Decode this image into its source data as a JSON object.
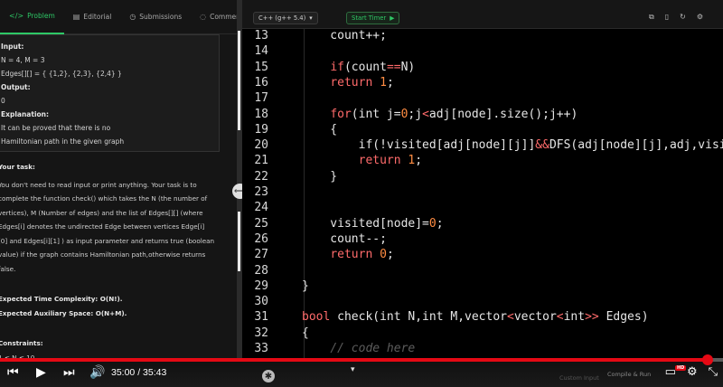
{
  "tabs": [
    {
      "icon": "</>",
      "label": "Problem",
      "active": true
    },
    {
      "icon": "▤",
      "label": "Editorial"
    },
    {
      "icon": "◷",
      "label": "Submissions"
    },
    {
      "icon": "◌",
      "label": "Comments"
    }
  ],
  "example": [
    {
      "text": "Input:",
      "bold": true
    },
    {
      "text": "N = 4, M = 3",
      "bold": false
    },
    {
      "text": "Edges[][] = { {1,2}, {2,3}, {2,4} }",
      "bold": false
    },
    {
      "text": "Output:",
      "bold": true
    },
    {
      "text": "0",
      "bold": false
    },
    {
      "text": "Explanation:",
      "bold": true
    },
    {
      "text": "It can be proved that there is no",
      "bold": false
    },
    {
      "text": "Hamiltonian path in the given graph",
      "bold": false
    }
  ],
  "task": {
    "heading": "Your task:",
    "lines": [
      "You don't need to read input or print anything. Your task is to",
      "complete the function check() which takes the N (the number of",
      "vertices), M (Number of edges) and the list of Edges[][] (where",
      "Edges[i] denotes the undirected Edge between vertices Edge[i]",
      "[0] and Edges[i][1] ) as input parameter and returns true (boolean",
      "value) if the graph contains Hamiltonian path,otherwise returns",
      "false."
    ],
    "time_complexity": "Expected Time Complexity: O(N!).",
    "space_complexity": "Expected Auxiliary Space: O(N+M).",
    "constraints_heading": "Constraints:",
    "constraints": [
      "1 ≤ N ≤ 10",
      "1 ≤ M ≤ 15",
      "Size of Edges[i] is 2"
    ]
  },
  "toolbar": {
    "language": "C++ (g++ 5.4)",
    "timer_label": "Start Timer"
  },
  "code": {
    "line_numbers": [
      "13",
      "14",
      "15",
      "16",
      "17",
      "18",
      "19",
      "20",
      "21",
      "22",
      "23",
      "24",
      "25",
      "26",
      "27",
      "28",
      "29",
      "30",
      "31",
      "32",
      "33"
    ],
    "lines": [
      [
        {
          "t": "    count++;"
        }
      ],
      [
        {
          "t": ""
        }
      ],
      [
        {
          "t": "    "
        },
        {
          "t": "if",
          "k": "kw"
        },
        {
          "t": "(count"
        },
        {
          "t": "==",
          "k": "kw"
        },
        {
          "t": "N)"
        }
      ],
      [
        {
          "t": "    "
        },
        {
          "t": "return",
          "k": "kw"
        },
        {
          "t": " "
        },
        {
          "t": "1",
          "k": "num"
        },
        {
          "t": ";"
        }
      ],
      [
        {
          "t": ""
        }
      ],
      [
        {
          "t": "    "
        },
        {
          "t": "for",
          "k": "kw"
        },
        {
          "t": "(int j="
        },
        {
          "t": "0",
          "k": "num"
        },
        {
          "t": ";j"
        },
        {
          "t": "<",
          "k": "kw"
        },
        {
          "t": "adj[node].size();j++)"
        }
      ],
      [
        {
          "t": "    {"
        }
      ],
      [
        {
          "t": "        if(!visited[adj[node][j]]"
        },
        {
          "t": "&&",
          "k": "kw"
        },
        {
          "t": "DFS(adj[node][j],adj,visit"
        }
      ],
      [
        {
          "t": "        "
        },
        {
          "t": "return",
          "k": "kw"
        },
        {
          "t": " "
        },
        {
          "t": "1",
          "k": "num"
        },
        {
          "t": ";"
        }
      ],
      [
        {
          "t": "    }"
        }
      ],
      [
        {
          "t": ""
        }
      ],
      [
        {
          "t": ""
        }
      ],
      [
        {
          "t": "    visited[node]="
        },
        {
          "t": "0",
          "k": "num"
        },
        {
          "t": ";"
        }
      ],
      [
        {
          "t": "    count--;"
        }
      ],
      [
        {
          "t": "    "
        },
        {
          "t": "return",
          "k": "kw"
        },
        {
          "t": " "
        },
        {
          "t": "0",
          "k": "num"
        },
        {
          "t": ";"
        }
      ],
      [
        {
          "t": ""
        }
      ],
      [
        {
          "t": "}"
        }
      ],
      [
        {
          "t": ""
        }
      ],
      [
        {
          "t": "bool",
          "k": "kw"
        },
        {
          "t": " check(int N,int M,vector"
        },
        {
          "t": "<",
          "k": "kw"
        },
        {
          "t": "vector"
        },
        {
          "t": "<",
          "k": "kw"
        },
        {
          "t": "int"
        },
        {
          "t": ">>",
          "k": "kw"
        },
        {
          "t": " Edges)"
        }
      ],
      [
        {
          "t": "{"
        }
      ],
      [
        {
          "t": "    "
        },
        {
          "t": "// code here",
          "k": "cmt"
        }
      ]
    ]
  },
  "video": {
    "time": "35:00 / 35:43",
    "progress": 0.979,
    "custom_input": "Custom Input",
    "compile_label": "Compile & Run",
    "hd_badge": "HD"
  }
}
